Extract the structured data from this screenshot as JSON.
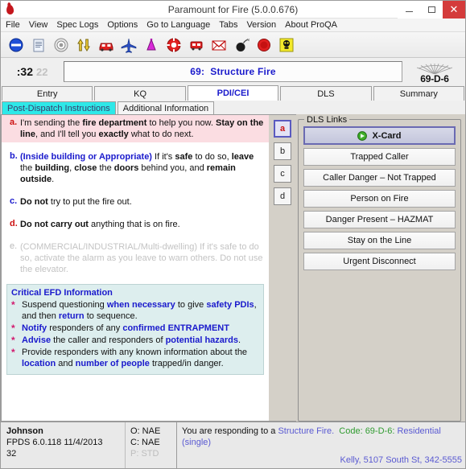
{
  "window": {
    "title": "Paramount for Fire (5.0.0.676)",
    "app_icon": "flame-icon",
    "minimize": "–",
    "maximize": "▢",
    "close": "✕"
  },
  "menubar": {
    "items": [
      {
        "label": "File"
      },
      {
        "label": "View"
      },
      {
        "label": "Spec Logs"
      },
      {
        "label": "Options"
      },
      {
        "label": "Go to Language"
      },
      {
        "label": "Tabs"
      },
      {
        "label": "Version"
      },
      {
        "label": "About ProQA"
      }
    ]
  },
  "toolbar": {
    "buttons": [
      {
        "name": "no-entry-icon"
      },
      {
        "name": "document-icon"
      },
      {
        "name": "target-icon"
      },
      {
        "name": "updown-arrows-icon"
      },
      {
        "name": "car-icon"
      },
      {
        "name": "airplane-icon"
      },
      {
        "name": "chemical-flask-icon"
      },
      {
        "name": "lifering-icon"
      },
      {
        "name": "train-icon"
      },
      {
        "name": "envelope-icon"
      },
      {
        "name": "bomb-icon"
      },
      {
        "name": "stop-icon"
      },
      {
        "name": "biohazard-skull-icon"
      }
    ]
  },
  "caseheader": {
    "timer_primary": ":32",
    "timer_secondary": "22",
    "case_number": "69:",
    "case_title": "Structure Fire",
    "determinant": "69-D-6"
  },
  "tabs": [
    {
      "label": "Entry",
      "active": false
    },
    {
      "label": "KQ",
      "active": false
    },
    {
      "label": "PDI/CEI",
      "active": true
    },
    {
      "label": "DLS",
      "active": false
    },
    {
      "label": "Summary",
      "active": false
    }
  ],
  "subtabs": [
    {
      "label": "Post-Dispatch Instructions",
      "active": true
    },
    {
      "label": "Additional Information",
      "active": false
    }
  ],
  "instructions": [
    {
      "letter": "a.",
      "highlighted": true,
      "disabled": false,
      "parts": [
        {
          "t": "I'm sending the ",
          "b": false
        },
        {
          "t": "fire department",
          "b": true
        },
        {
          "t": " to help you now.  ",
          "b": false
        },
        {
          "t": "Stay on the line",
          "b": true
        },
        {
          "t": ", and I'll tell you ",
          "b": false
        },
        {
          "t": "exactly",
          "b": true
        },
        {
          "t": " what to do next.",
          "b": false
        }
      ]
    },
    {
      "letter": "b.",
      "highlighted": false,
      "disabled": false,
      "parts": [
        {
          "t": "(Inside building or Appropriate)",
          "b": true,
          "blue": true
        },
        {
          "t": " If it's ",
          "b": false
        },
        {
          "t": "safe",
          "b": true
        },
        {
          "t": " to do so, ",
          "b": false
        },
        {
          "t": "leave",
          "b": true
        },
        {
          "t": " the ",
          "b": false
        },
        {
          "t": "building",
          "b": true
        },
        {
          "t": ", ",
          "b": false
        },
        {
          "t": "close",
          "b": true
        },
        {
          "t": " the ",
          "b": false
        },
        {
          "t": "doors",
          "b": true
        },
        {
          "t": " behind you, and ",
          "b": false
        },
        {
          "t": "remain outside",
          "b": true
        },
        {
          "t": ".",
          "b": false
        }
      ]
    },
    {
      "letter": "c.",
      "highlighted": false,
      "disabled": false,
      "parts": [
        {
          "t": "Do not",
          "b": true
        },
        {
          "t": " try to put the fire out.",
          "b": false
        }
      ]
    },
    {
      "letter": "d.",
      "highlighted": false,
      "disabled": false,
      "parts": [
        {
          "t": "Do not carry out",
          "b": true
        },
        {
          "t": " anything that is on fire.",
          "b": false
        }
      ]
    },
    {
      "letter": "e.",
      "highlighted": false,
      "disabled": true,
      "parts": [
        {
          "t": "(COMMERCIAL/INDUSTRIAL/Multi-dwelling) If it's safe to do so, activate the alarm as you leave to warn others.  Do not use the elevator.",
          "b": false
        }
      ]
    }
  ],
  "efd": {
    "title": "Critical EFD Information",
    "bullet": "*",
    "items": [
      [
        {
          "t": "Suspend questioning ",
          "b": false
        },
        {
          "t": "when necessary",
          "b": true
        },
        {
          "t": " to give ",
          "b": false
        },
        {
          "t": "safety PDIs",
          "b": true
        },
        {
          "t": ", and then ",
          "b": false
        },
        {
          "t": "return",
          "b": true
        },
        {
          "t": " to sequence.",
          "b": false
        }
      ],
      [
        {
          "t": "Notify",
          "b": true
        },
        {
          "t": " responders of any ",
          "b": false
        },
        {
          "t": "confirmed ",
          "b": true
        },
        {
          "t": "ENTRAPMENT",
          "b": true,
          "green": true
        }
      ],
      [
        {
          "t": "Advise",
          "b": true
        },
        {
          "t": " the caller and responders of ",
          "b": false
        },
        {
          "t": "potential hazards",
          "b": true
        },
        {
          "t": ".",
          "b": false
        }
      ],
      [
        {
          "t": "Provide responders with any known information about the ",
          "b": false
        },
        {
          "t": "location",
          "b": true
        },
        {
          "t": " and ",
          "b": false
        },
        {
          "t": "number of people",
          "b": true
        },
        {
          "t": " trapped/in danger.",
          "b": false
        }
      ]
    ]
  },
  "letter_column": [
    {
      "label": "a",
      "selected": true
    },
    {
      "label": "b",
      "selected": false
    },
    {
      "label": "c",
      "selected": false
    },
    {
      "label": "d",
      "selected": false
    }
  ],
  "dls_links": {
    "title": "DLS Links",
    "buttons": [
      {
        "label": "X-Card",
        "primary": true,
        "icon": "green-arrow-circle-icon"
      },
      {
        "label": "Trapped Caller",
        "primary": false
      },
      {
        "label": "Caller Danger – Not Trapped",
        "primary": false
      },
      {
        "label": "Person on Fire",
        "primary": false
      },
      {
        "label": "Danger Present – HAZMAT",
        "primary": false
      },
      {
        "label": "Stay on the Line",
        "primary": false
      },
      {
        "label": "Urgent Disconnect",
        "primary": false
      }
    ]
  },
  "statusbar": {
    "operator": "Johnson",
    "protocol_version": "FPDS  6.0.118  11/4/2013",
    "case_count": "32",
    "o_label": "O: NAE",
    "c_label": "C: NAE",
    "p_label": "P: STD",
    "response_prefix": "You are responding to a ",
    "response_type": "Structure Fire.",
    "code_label": "Code: 69-D-6:",
    "response_detail": "Residential (single)",
    "caller_info": "Kelly, 5107 South St, 342-5555"
  },
  "colors": {
    "accent_blue": "#1a1acc",
    "highlight_pink": "#fbdde2",
    "cyan_tab": "#2ee8e8",
    "efd_bg": "#ddeeee",
    "green": "#2f9b2f",
    "red_letter": "#cc1111"
  }
}
